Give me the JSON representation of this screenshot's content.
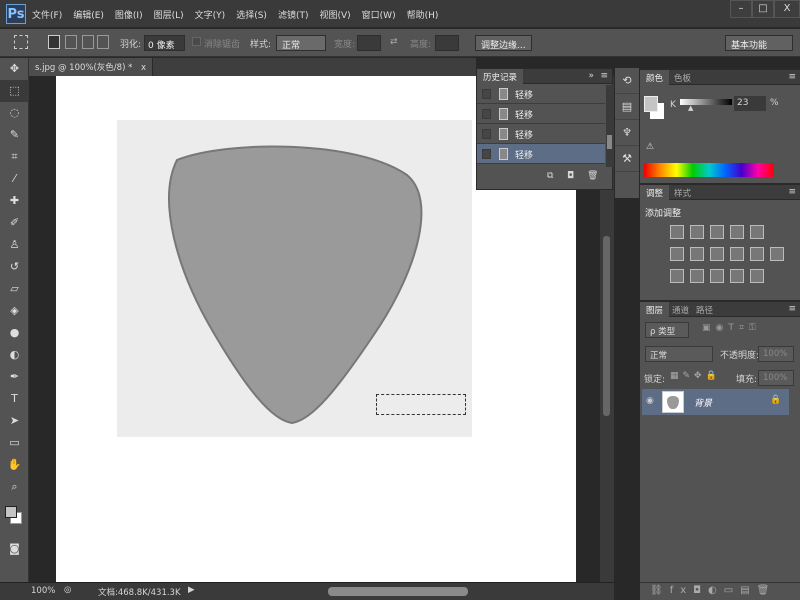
{
  "app": {
    "logo": "Ps"
  },
  "menu": [
    "文件(F)",
    "编辑(E)",
    "图像(I)",
    "图层(L)",
    "文字(Y)",
    "选择(S)",
    "滤镜(T)",
    "视图(V)",
    "窗口(W)",
    "帮助(H)"
  ],
  "window_controls": {
    "minimize": "–",
    "maximize": "□",
    "close": "X"
  },
  "options_bar": {
    "feather_label": "羽化:",
    "feather_value": "0 像素",
    "antialias_label": "消除锯齿",
    "style_label": "样式:",
    "style_value": "正常",
    "width_label": "宽度:",
    "height_label": "高度:",
    "refine_edge": "调整边缘...",
    "workspace": "基本功能"
  },
  "document": {
    "tab_title": "s.jpg @ 100%(灰色/8) *",
    "close": "x"
  },
  "status": {
    "zoom": "100%",
    "doc_info": "文档:468.8K/431.3K"
  },
  "history": {
    "tab": "历史记录",
    "items": [
      "轻移",
      "轻移",
      "轻移",
      "轻移"
    ],
    "selected_index": 3
  },
  "color_panel": {
    "tabs": [
      "颜色",
      "色板"
    ],
    "channel": "K",
    "value": "23",
    "unit": "%"
  },
  "adjustments": {
    "tabs": [
      "调整",
      "样式"
    ],
    "title": "添加调整"
  },
  "layers": {
    "tabs": [
      "图层",
      "通道",
      "路径"
    ],
    "filter": "ρ 类型",
    "blend_mode": "正常",
    "opacity_label": "不透明度:",
    "opacity": "100%",
    "lock_label": "锁定:",
    "fill_label": "填充:",
    "fill": "100%",
    "items": [
      {
        "name": "背景",
        "locked": true,
        "visible": true
      }
    ]
  },
  "colors": {
    "accent_selection": "#5d6d86",
    "panel": "#535353"
  }
}
